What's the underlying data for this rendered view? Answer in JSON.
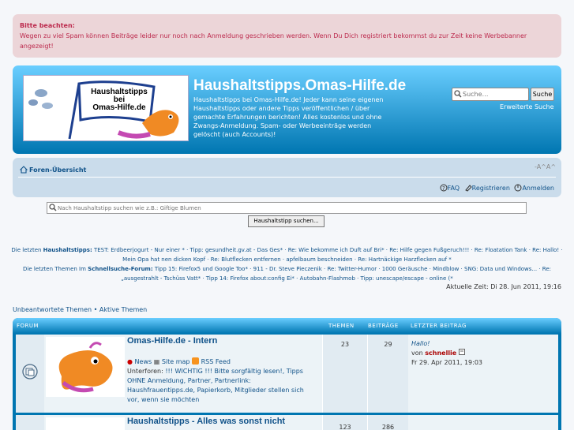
{
  "notice": {
    "title": "Bitte beachten:",
    "text": "Wegen zu viel Spam können Beiträge leider nur noch nach Anmeldung geschrieben werden. Wenn Du Dich registriert bekommst du zur Zeit keine Werbebanner angezeigt!"
  },
  "header": {
    "logo_line1": "Haushaltstipps",
    "logo_line2": "bei",
    "logo_line3": "Omas-Hilfe.de",
    "title": "Haushaltstipps.Omas-Hilfe.de",
    "description": "Haushaltstipps bei Omas-Hilfe.de! Jeder kann seine eigenen Haushaltstipps oder andere Tipps veröffentlichen / über gemachte Erfahrungen berichten! Alles kostenlos und ohne Zwangs-Anmeldung. Spam- oder Werbeeinträge werden gelöscht (auch Accounts)!",
    "search_placeholder": "Suche…",
    "search_button": "Suche",
    "advanced_search": "Erweiterte Suche"
  },
  "navbar": {
    "home": "Foren-Übersicht",
    "fontsize": "-A^A^",
    "faq": "FAQ",
    "register": "Registrieren",
    "login": "Anmelden"
  },
  "keyword_search": {
    "placeholder": "Nach Haushaltstipp suchen wie z.B.: Giftige Blumen",
    "button": "Haushaltstipp suchen..."
  },
  "ticker": {
    "prefix1": "Die letzten ",
    "bold1": "Haushaltstipps:",
    "items1": " TEST: Erdbeerjogurt - Nur einer * · Tipp: gesundheit.gv.at - Das Ges* · Re: Wie bekomme ich Duft auf Bri* · Re: Hilfe gegen Fußgeruch!!! · Re: Floatation Tank · Re: Hallo! · Mein Opa hat nen dicken Kopf · Re: Blutflecken entfernen · apfelbaum beschneiden · Re: Hartnäckige Harzflecken auf *",
    "prefix2": "Die letzten Themen Im ",
    "bold2": "Schnellsuche-Forum:",
    "items2": " Tipp 15: Firefox5 und Google Too* · 911 - Dr. Steve Pieczenik · Re: Twitter-Humor · 1000 Geräusche · Mindblow · SNG: Data und Windows... · Re: „ausgestrahlt - Tschüss Vatt* · Tipp 14: Firefox about:config Ei* · Autobahn-Flashmob · Tipp: unescape/escape - online (*"
  },
  "current_time": "Aktuelle Zeit: Di 28. Jun 2011, 19:16",
  "quicklinks": {
    "unanswered": "Unbeantwortete Themen",
    "sep": " • ",
    "active": "Aktive Themen"
  },
  "forum_table": {
    "col_forum": "FORUM",
    "col_topics": "THEMEN",
    "col_posts": "BEITRÄGE",
    "col_last": "LETZTER BEITRAG",
    "rows": [
      {
        "title": "Omas-Hilfe.de - Intern",
        "links": [
          "News",
          "Site map",
          "RSS Feed"
        ],
        "subforums_label": "Unterforen:",
        "subforums": "!!! WICHTIG !!! Bitte sorgfältig lesen!, Tipps OHNE Anmeldung, Partner, Partnerlink: Haushfrauentipps.de, Papierkorb, Mitglieder stellen sich vor, wenn sie möchten",
        "topics": "23",
        "posts": "29",
        "last_title": "Hallo!",
        "last_by": "von ",
        "last_user": "schnellie",
        "last_date": "Fr 29. Apr 2011, 19:03"
      },
      {
        "title": "Haushaltstipps - Alles was sonst nicht",
        "topics": "123",
        "posts": "286"
      }
    ]
  },
  "colors": {
    "accent": "#105289",
    "header_top": "#6aceff",
    "header_bottom": "#0076b1",
    "notice_bg": "#ecd5d8",
    "notice_text": "#bc2a4d"
  }
}
